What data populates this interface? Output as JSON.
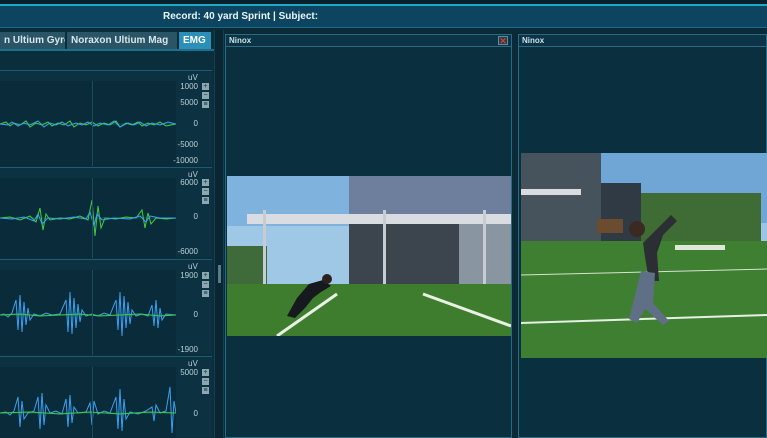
{
  "record_title": "Record: 40 yard Sprint | Subject:",
  "tabs": [
    {
      "label": "n Ultium Gyro",
      "active": false
    },
    {
      "label": "Noraxon Ultium Mag",
      "active": false
    },
    {
      "label": "EMG",
      "active": true
    }
  ],
  "channels": [
    {
      "unit": "uV",
      "ticks": [
        "1000",
        "5000",
        "0",
        "-5000",
        "-10000"
      ],
      "signal_color": "green+blue"
    },
    {
      "unit": "uV",
      "ticks": [
        "6000",
        "0",
        "-6000"
      ],
      "signal_color": "green+blue"
    },
    {
      "unit": "uV",
      "ticks": [
        "1900",
        "0",
        "-1900"
      ],
      "signal_color": "blue"
    },
    {
      "unit": "uV",
      "ticks": [
        "5000",
        "0"
      ],
      "signal_color": "blue"
    }
  ],
  "zoom_buttons": {
    "plus": "+",
    "minus": "−",
    "menu": "≡"
  },
  "videos": [
    {
      "title": "Ninox",
      "close": "✕"
    },
    {
      "title": "Ninox",
      "close": ""
    }
  ],
  "colors": {
    "accent": "#2b8fb8",
    "emg_green": "#3fcf3a",
    "emg_blue": "#3aa0f0",
    "background": "#0a2a38"
  }
}
